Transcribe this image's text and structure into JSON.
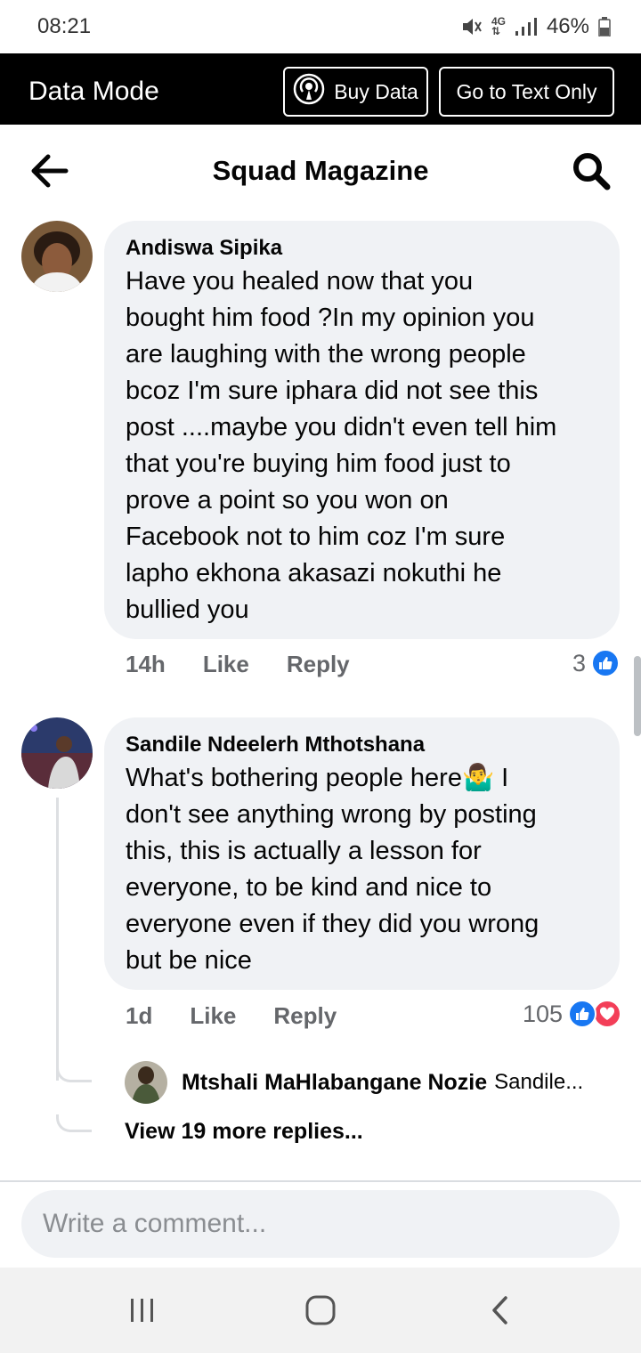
{
  "status_bar": {
    "time": "08:21",
    "battery": "46%"
  },
  "data_bar": {
    "mode_label": "Data Mode",
    "buy_data_label": "Buy Data",
    "text_only_label": "Go to Text Only"
  },
  "header": {
    "title": "Squad Magazine"
  },
  "comments": [
    {
      "author": "Andiswa Sipika",
      "text_lines": [
        "Have you healed now that you",
        "bought him food ?In my opinion you",
        "are laughing with the wrong people",
        "bcoz I'm sure iphara did not see this",
        "post ....maybe you didn't even tell him",
        "that you're buying him food just to",
        "prove a point so you won on",
        "Facebook not to him coz I'm sure",
        "lapho ekhona akasazi nokuthi he",
        "bullied you"
      ],
      "time": "14h",
      "like_label": "Like",
      "reply_label": "Reply",
      "reaction_count": "3"
    },
    {
      "author": "Sandile Ndeelerh Mthotshana",
      "text_lines": [
        "What's bothering people here🤷‍♂️ I",
        "don't see anything wrong by posting",
        "this, this is actually a lesson for",
        "everyone, to be kind and nice to",
        "everyone even if they did you wrong",
        "but be nice"
      ],
      "time": "1d",
      "like_label": "Like",
      "reply_label": "Reply",
      "reaction_count": "105"
    }
  ],
  "reply_preview": {
    "author": "Mtshali MaHlabangane Nozie",
    "snippet": "Sandile..."
  },
  "more_replies": "View 19 more replies...",
  "composer": {
    "placeholder": "Write a comment..."
  },
  "colors": {
    "like_blue": "#1877f2",
    "love_red": "#f33e58",
    "bubble_bg": "#f0f2f5",
    "meta_grey": "#65676b"
  }
}
